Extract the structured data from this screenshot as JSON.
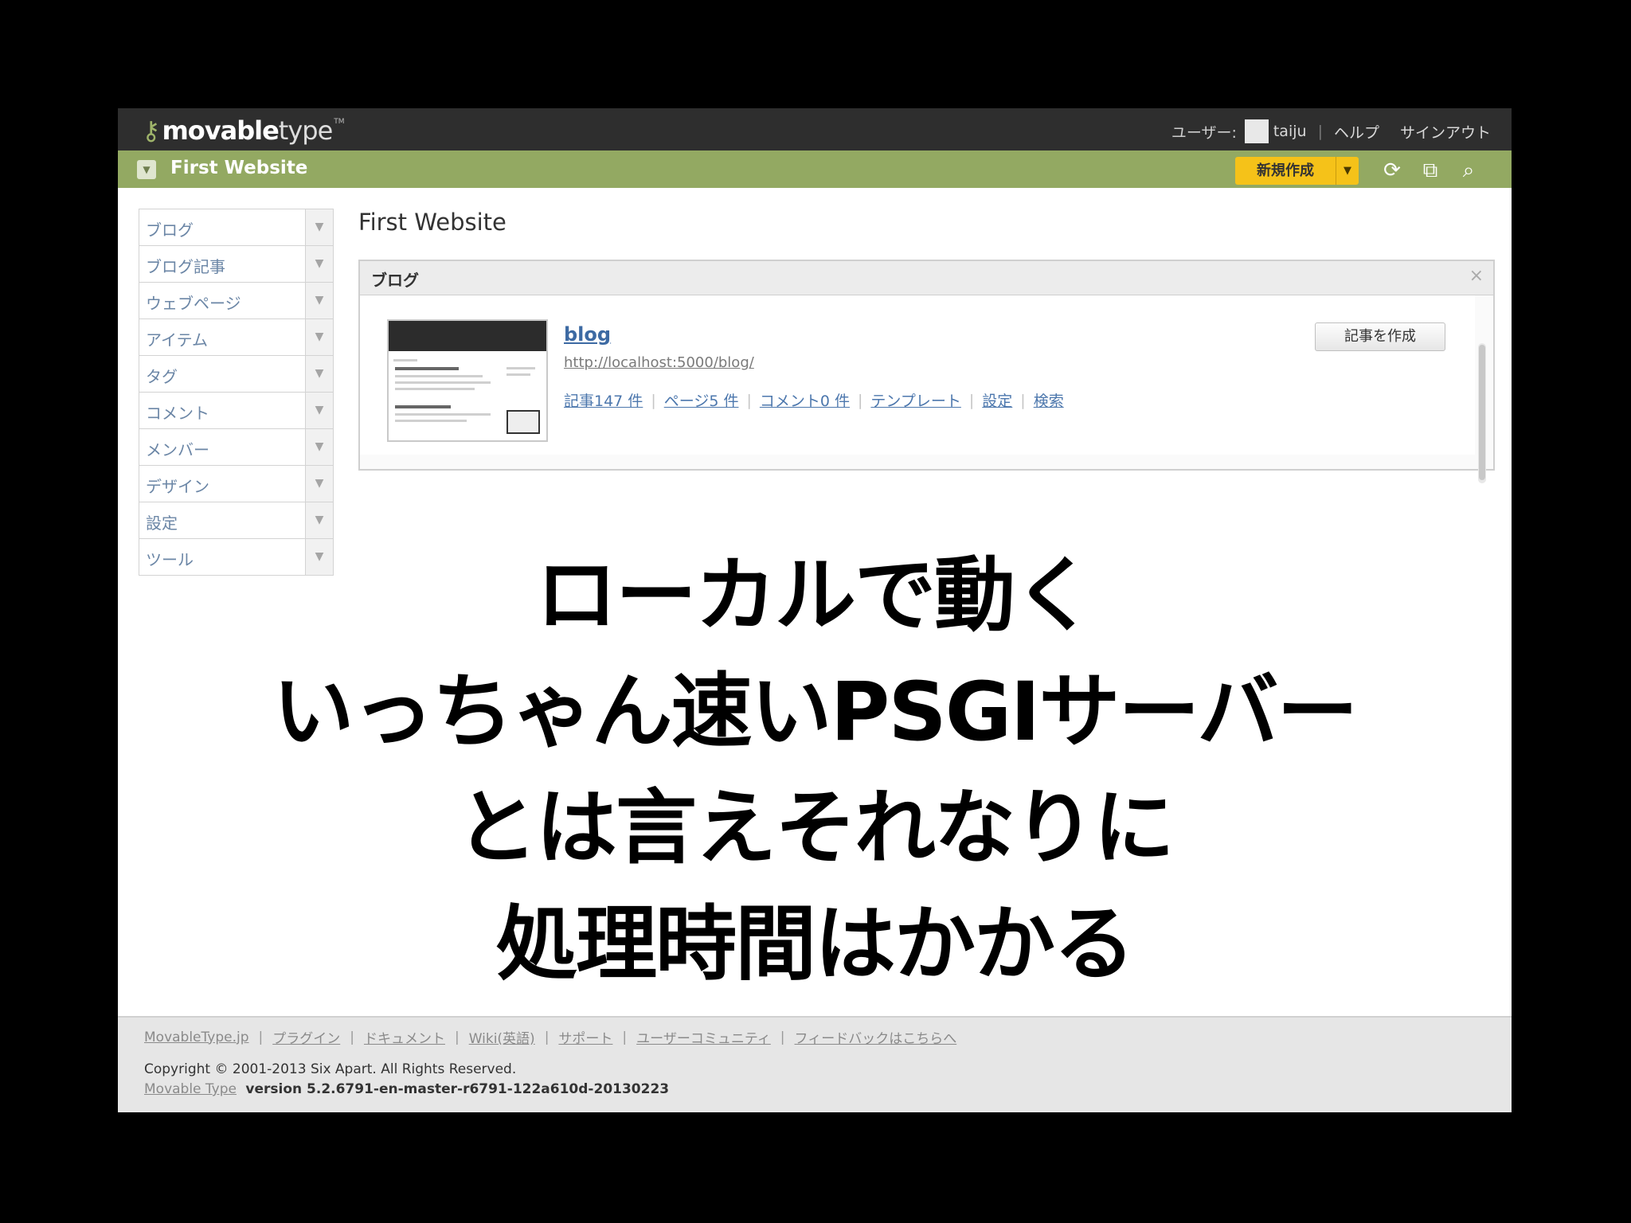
{
  "app": {
    "brand_bold": "movable",
    "brand_light": "type",
    "tm": "TM"
  },
  "user_nav": {
    "user_label": "ユーザー:",
    "username": "taiju",
    "help": "ヘルプ",
    "signout": "サインアウト"
  },
  "site_bar": {
    "title": "First Website",
    "new_button": "新規作成"
  },
  "sidebar": {
    "items": [
      {
        "label": "ブログ"
      },
      {
        "label": "ブログ記事"
      },
      {
        "label": "ウェブページ"
      },
      {
        "label": "アイテム"
      },
      {
        "label": "タグ"
      },
      {
        "label": "コメント"
      },
      {
        "label": "メンバー"
      },
      {
        "label": "デザイン"
      },
      {
        "label": "設定"
      },
      {
        "label": "ツール"
      }
    ]
  },
  "main": {
    "page_title": "First Website",
    "widget": {
      "title": "ブログ",
      "close": "×",
      "blog": {
        "name": "blog",
        "url": "http://localhost:5000/blog/",
        "links": [
          "記事147 件",
          "ページ5 件",
          "コメント0 件",
          "テンプレート",
          "設定",
          "検索"
        ],
        "create_button": "記事を作成"
      }
    }
  },
  "caption": {
    "lines": [
      "ローカルで動く",
      "いっちゃん速いPSGIサーバー",
      "とは言えそれなりに",
      "処理時間はかかる"
    ]
  },
  "footer": {
    "links": [
      "MovableType.jp",
      "プラグイン",
      "ドキュメント",
      "Wiki(英語)",
      "サポート",
      "ユーザーコミュニティ",
      "フィードバックはこちらへ"
    ],
    "copyright": "Copyright © 2001-2013 Six Apart. All Rights Reserved.",
    "product_link": "Movable Type",
    "version": "version 5.2.6791-en-master-r6791-122a610d-20130223"
  }
}
